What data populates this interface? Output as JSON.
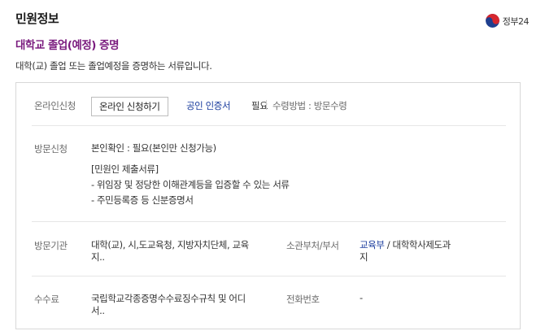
{
  "header": {
    "title": "민원정보",
    "logo_text": "정부24"
  },
  "service": {
    "title": "대학교 졸업(예정) 증명",
    "description": "대학(교) 졸업 또는 졸업예정을 증명하는 서류입니다."
  },
  "online": {
    "label": "온라인신청",
    "button_label": "온라인 신청하기",
    "cert_link": "공인 인증서",
    "cert_required": "필요",
    "receive_method": "수령방법 : 방문수령"
  },
  "visit": {
    "label": "방문신청",
    "identity_check": "본인확인 : 필요(본인만 신청가능)",
    "documents_heading": "[민원인 제출서류]",
    "documents": [
      "- 위임장 및 정당한 이해관계등을 입증할 수 있는 서류",
      "- 주민등록증 등 신분증명서"
    ]
  },
  "agency": {
    "label": "방문기관",
    "value_line1": "대학(교), 시,도교육청, 지방자치단체, 교육",
    "value_line2": "지..",
    "dept_label": "소관부처/부서",
    "dept_link": "교육부",
    "dept_rest_line1": " / 대학학사제도과",
    "dept_rest_line2": "지"
  },
  "fee": {
    "label": "수수료",
    "value_line1": "국립학교각종증명수수료징수규칙 및 어디",
    "value_line2": "서..",
    "phone_label": "전화번호",
    "phone_value": "-"
  },
  "colors": {
    "title_purple": "#7a1b7e",
    "link_blue": "#1b3d9e",
    "border": "#d8d8d8"
  },
  "icons": {
    "logo": "taegeuk-emblem-icon"
  }
}
